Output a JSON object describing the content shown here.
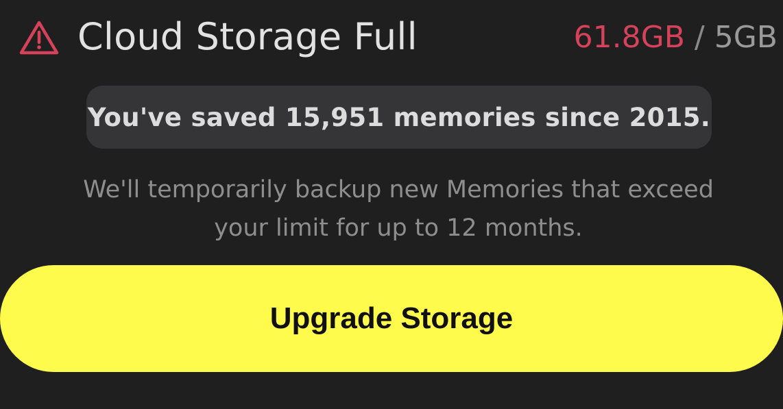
{
  "header": {
    "title": "Cloud Storage Full",
    "icon": "warning-triangle-icon",
    "usage": {
      "used": "61.8GB",
      "separator": " / ",
      "limit": "5GB"
    }
  },
  "summary": {
    "text": "You've saved 15,951 memories since 2015."
  },
  "note": {
    "line1": "We'll temporarily backup new Memories that exceed",
    "line2": "your limit for up to 12 months."
  },
  "actions": {
    "upgrade_label": "Upgrade Storage"
  },
  "colors": {
    "background": "#1f1f20",
    "pill": "#353537",
    "alert_red": "#d54259",
    "button_yellow": "#fffb4c"
  }
}
